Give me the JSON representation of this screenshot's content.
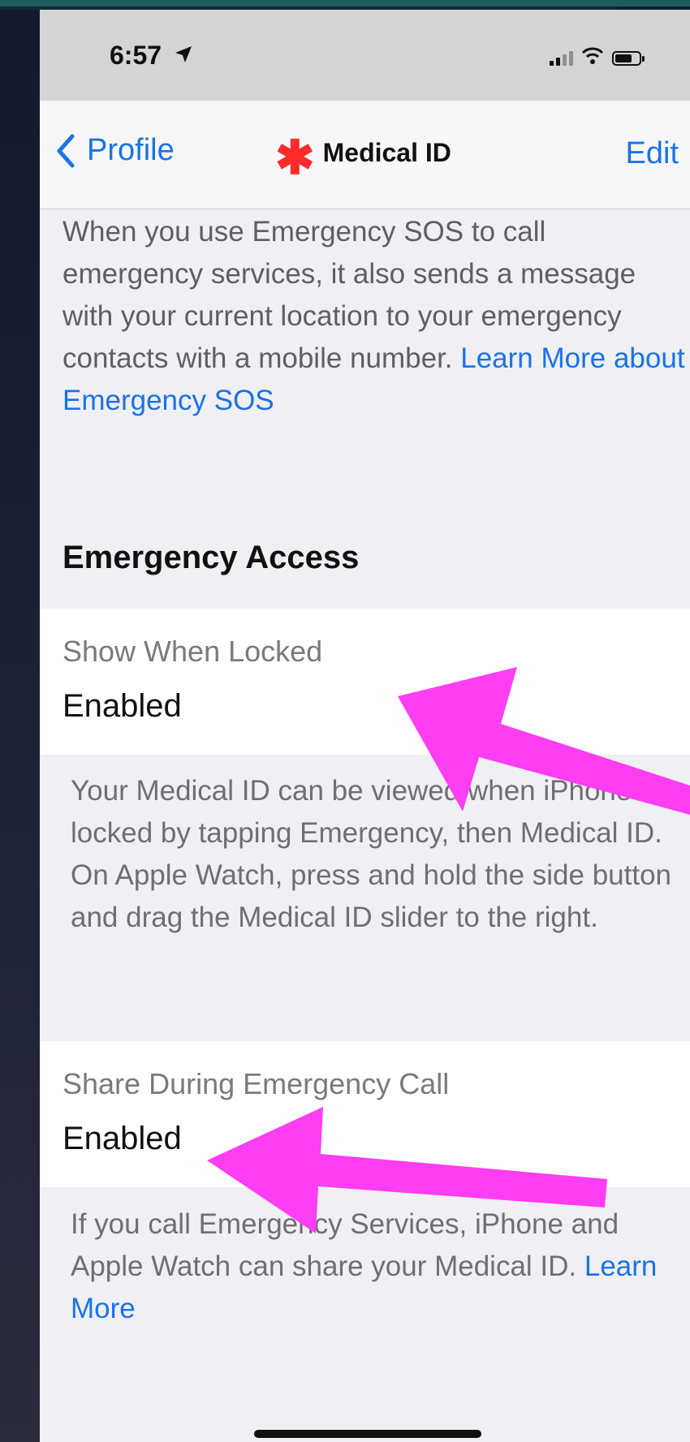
{
  "status_bar": {
    "time": "6:57"
  },
  "nav": {
    "back_label": "Profile",
    "title": "Medical ID",
    "edit_label": "Edit"
  },
  "sos_info": {
    "text": "When you use Emergency SOS to call emergency services, it also sends a message with your current location to your emergency contacts with a mobile number. ",
    "link": "Learn More about Emergency SOS"
  },
  "emergency_access": {
    "heading": "Emergency Access",
    "show_when_locked": {
      "label": "Show When Locked",
      "value": "Enabled",
      "footer": "Your Medical ID can be viewed when iPhone is locked by tapping Emergency, then Medical ID. On Apple Watch, press and hold the side button and drag the Medical ID slider to the right."
    },
    "share_during_call": {
      "label": "Share During Emergency Call",
      "value": "Enabled",
      "footer": "If you call Emergency Services, iPhone and Apple Watch can share your Medical ID. ",
      "footer_link": "Learn More"
    }
  },
  "colors": {
    "link": "#1a73e8",
    "annotation_arrow": "#ff3df2",
    "medical_asterisk": "#ff2a2a"
  },
  "icons": [
    "location-arrow-icon",
    "signal-icon",
    "wifi-icon",
    "battery-icon",
    "chevron-left-icon",
    "medical-asterisk-icon"
  ]
}
